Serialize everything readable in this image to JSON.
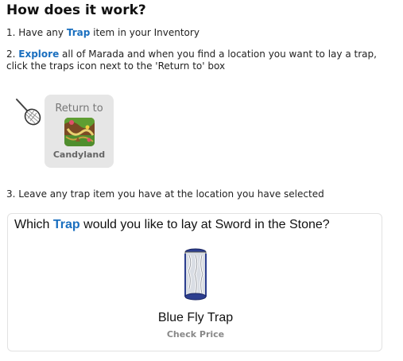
{
  "heading": "How does it work?",
  "step1": {
    "prefix": "1. Have any ",
    "keyword": "Trap",
    "suffix": " item in your Inventory"
  },
  "step2": {
    "prefix": "2. ",
    "keyword": "Explore",
    "suffix": " all of Marada and when you find a location you want to lay a trap, click the traps icon next to the 'Return to' box"
  },
  "return_box": {
    "label": "Return to",
    "location": "Candyland"
  },
  "step3": "3. Leave any trap item you have at the location you have selected",
  "trap_panel": {
    "question_prefix": "Which ",
    "question_keyword": "Trap",
    "question_suffix": " would you like to lay at Sword in the Stone?",
    "item_name": "Blue Fly Trap",
    "check_price": "Check Price"
  },
  "colors": {
    "keyword": "#1a6fbf",
    "return_box_bg": "#e6e6e6"
  },
  "icons": {
    "trap_icon": "butterfly-net-icon",
    "location_thumb": "candyland-thumbnail",
    "trap_item": "blue-fly-trap-image"
  }
}
